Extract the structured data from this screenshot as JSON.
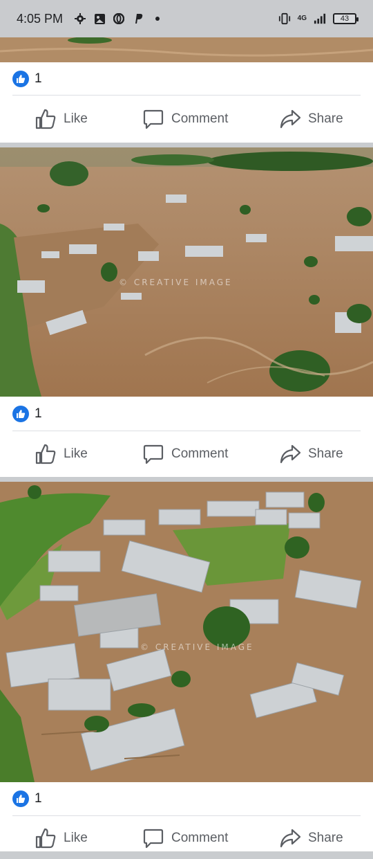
{
  "status_bar": {
    "time": "4:05 PM",
    "network": "4G",
    "battery": "43",
    "icons": [
      "gear-icon",
      "photo-icon",
      "opera-icon",
      "paypal-icon",
      "dot-icon",
      "vibrate-icon",
      "signal-icon",
      "battery-icon"
    ]
  },
  "posts": [
    {
      "like_count": "1",
      "actions": {
        "like": "Like",
        "comment": "Comment",
        "share": "Share"
      }
    },
    {
      "photo_watermark": "© CREATIVE IMAGE",
      "like_count": "1",
      "actions": {
        "like": "Like",
        "comment": "Comment",
        "share": "Share"
      }
    },
    {
      "photo_watermark": "© CREATIVE IMAGE",
      "like_count": "1",
      "actions": {
        "like": "Like",
        "comment": "Comment",
        "share": "Share"
      }
    }
  ],
  "colors": {
    "facebook_blue": "#1b74e4",
    "action_gray": "#5b5e63",
    "flood_water": "#a77b55"
  }
}
